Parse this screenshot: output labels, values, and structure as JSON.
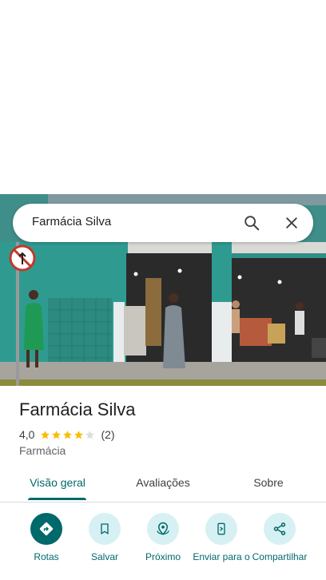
{
  "search": {
    "query": "Farmácia Silva"
  },
  "place": {
    "name": "Farmácia Silva",
    "rating": "4,0",
    "stars_filled": 4,
    "stars_total": 5,
    "review_count": "(2)",
    "category": "Farmácia"
  },
  "tabs": [
    {
      "label": "Visão geral"
    },
    {
      "label": "Avaliações"
    },
    {
      "label": "Sobre"
    }
  ],
  "actions": [
    {
      "label": "Rotas",
      "icon": "directions-icon"
    },
    {
      "label": "Salvar",
      "icon": "bookmark-icon"
    },
    {
      "label": "Próximo",
      "icon": "nearby-icon"
    },
    {
      "label": "Enviar para o",
      "icon": "send-to-phone-icon"
    },
    {
      "label": "Compartilhar",
      "icon": "share-icon"
    }
  ],
  "colors": {
    "accent": "#00696b",
    "action_bg": "#d7f0f3",
    "star": "#fbbc04"
  }
}
